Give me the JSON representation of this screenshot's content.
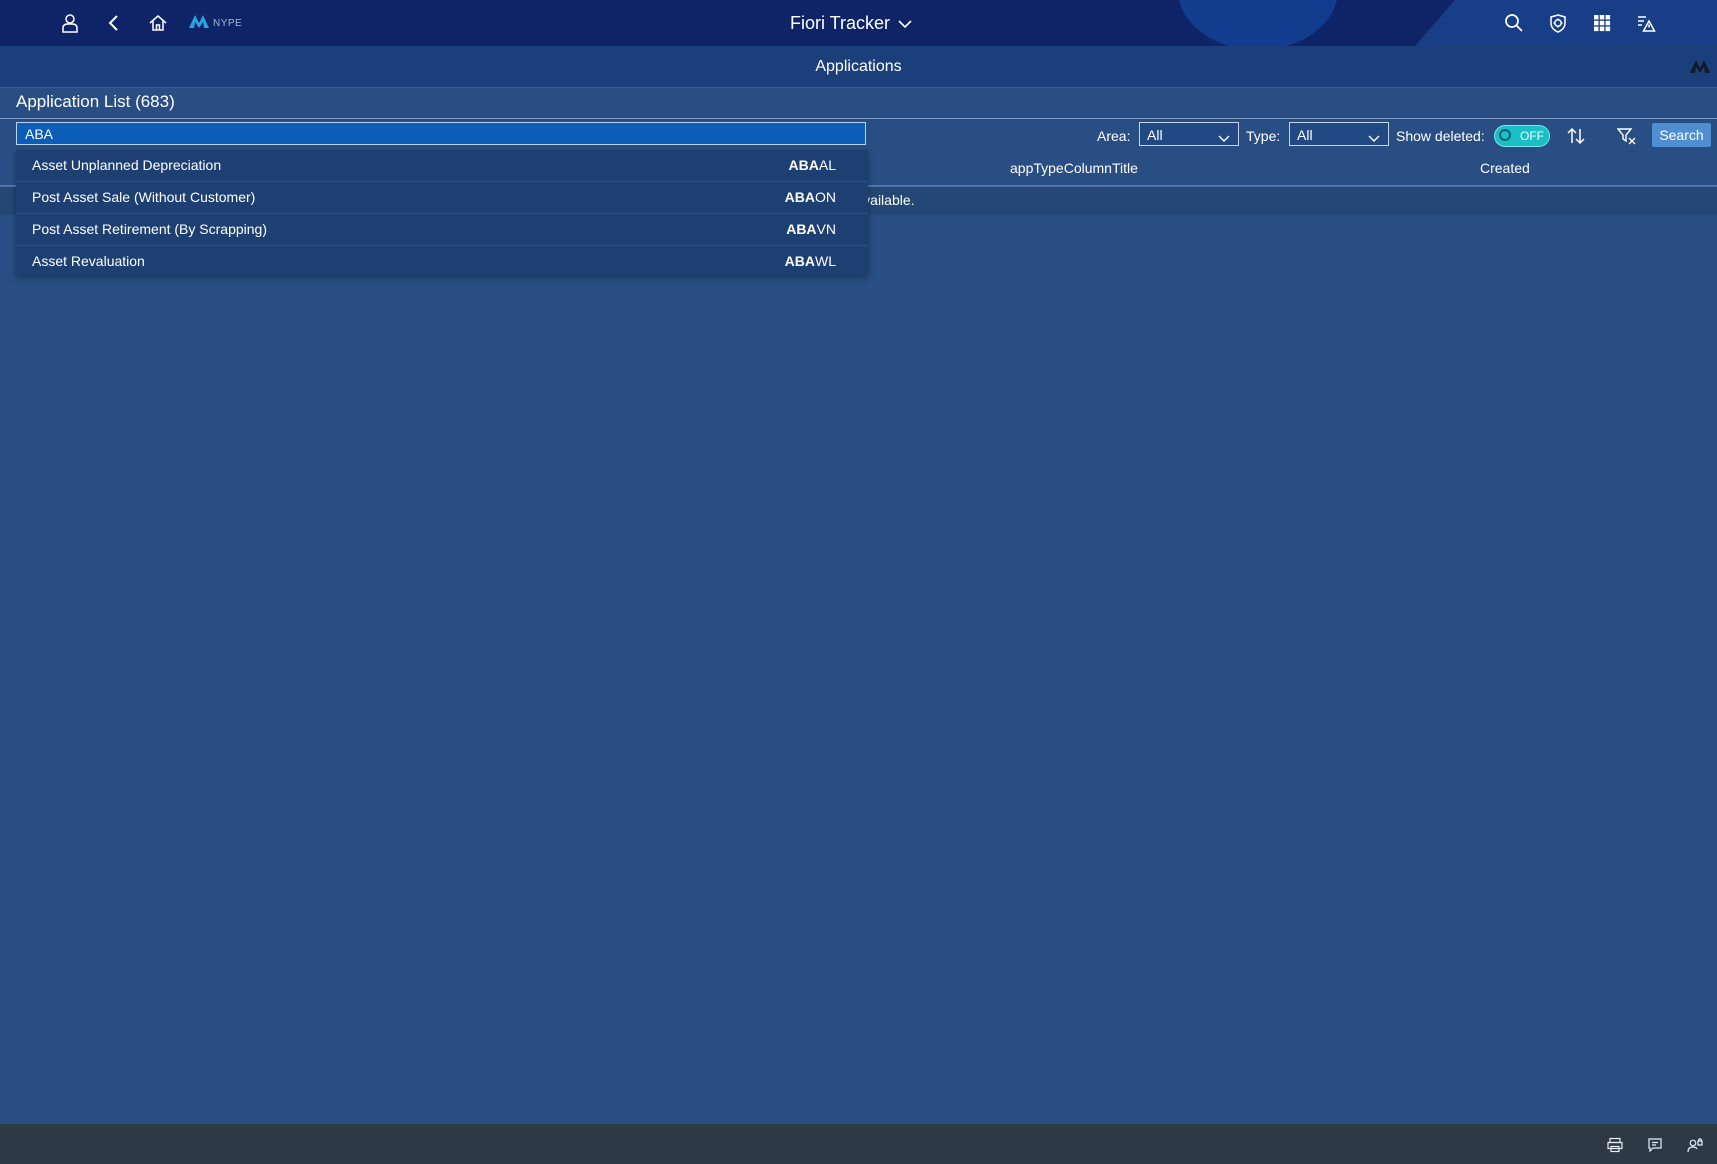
{
  "shell": {
    "logo_text": "NYPE",
    "app_title": "Fiori Tracker"
  },
  "subheader": {
    "title": "Applications"
  },
  "list": {
    "title": "Application List (683)",
    "search_value": "ABA",
    "area_label": "Area:",
    "area_value": "All",
    "type_label": "Type:",
    "type_value": "All",
    "show_deleted_label": "Show deleted:",
    "show_deleted_state": "OFF",
    "search_button": "Search"
  },
  "table": {
    "columns": [
      "appTypeColumnTitle",
      "Created"
    ],
    "no_data_text": "No data available."
  },
  "suggestions": [
    {
      "name": "Asset Unplanned Depreciation",
      "match": "ABA",
      "rest": "AL"
    },
    {
      "name": "Post Asset Sale (Without Customer)",
      "match": "ABA",
      "rest": "ON"
    },
    {
      "name": "Post Asset Retirement (By Scrapping)",
      "match": "ABA",
      "rest": "VN"
    },
    {
      "name": "Asset Revaluation",
      "match": "ABA",
      "rest": "WL"
    }
  ],
  "colors": {
    "shell_bg": "#0e2466",
    "page_bg": "#284e83",
    "accent": "#4f8ed0",
    "switch": "#19c0c6",
    "footer_bg": "#2d3a46"
  },
  "icons": [
    "user-icon",
    "back-icon",
    "home-icon",
    "logo-icon",
    "chevron-down-icon",
    "search-icon",
    "notifications-icon",
    "app-grid-icon",
    "text-alert-icon",
    "sort-icon",
    "clear-filter-icon",
    "print-icon",
    "comment-icon",
    "user-lock-icon"
  ]
}
